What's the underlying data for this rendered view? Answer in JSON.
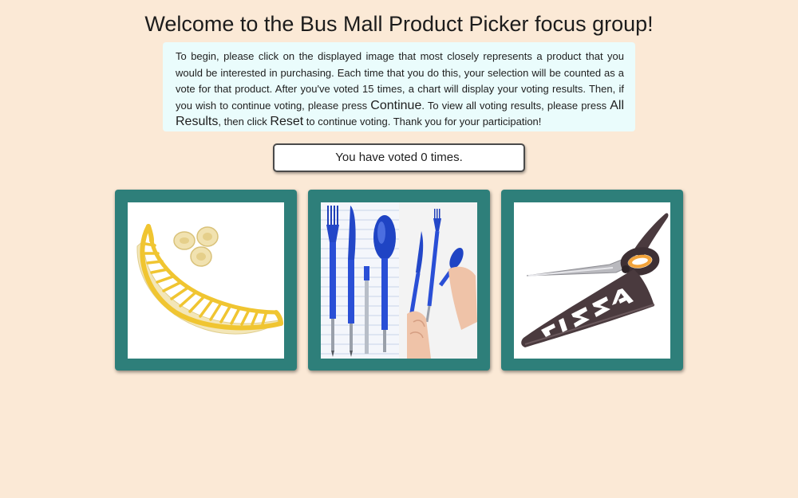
{
  "page": {
    "title": "Welcome to the Bus Mall Product Picker focus group!"
  },
  "instructions": {
    "part1": "To begin, please click on the displayed image that most closely represents a product that you would be interested in purchasing. Each time that you do this, your selection will be counted as a vote for that product. After you've voted 15 times, a chart will display your voting results. Then, if you wish to continue voting, please press ",
    "continue_label": "Continue",
    "part2": ". To view all voting results, please press ",
    "all_results_label": "All Results",
    "part3": ", then click ",
    "reset_label": "Reset",
    "part4": " to continue voting. Thank you for your participation!"
  },
  "vote_counter": {
    "text": "You have voted 0 times."
  },
  "products": [
    {
      "icon": "banana-slicer-image"
    },
    {
      "icon": "blue-pen-utensils-image"
    },
    {
      "icon": "pizza-scissors-image"
    }
  ],
  "colors": {
    "page_background": "#fbe9d6",
    "instructions_background": "#eafcfc",
    "card_frame": "#2e7f7a",
    "image_background": "#ffffff"
  }
}
